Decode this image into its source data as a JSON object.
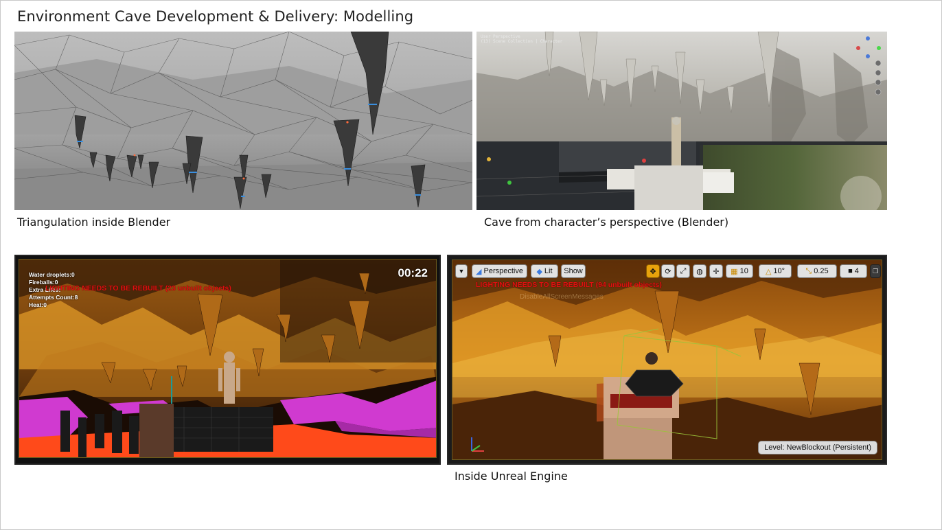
{
  "slide": {
    "title": "Environment Cave Development & Delivery: Modelling",
    "captions": {
      "blender_triangulation": "Triangulation inside Blender",
      "blender_character": "Cave from character’s perspective (Blender)",
      "unreal": "Inside Unreal Engine"
    }
  },
  "blender_view": {
    "overlay_title": "User Perspective",
    "overlay_collection": "(13) Scene Collection | Character"
  },
  "game_view": {
    "hud": {
      "water_droplets": "Water droplets:0",
      "fireballs": "Fireballs:0",
      "extra_lives": "Extra Lifes:",
      "attempts": "Attempts Count:8",
      "heat": "Heat:0"
    },
    "warning": "LIGHTING NEEDS TO BE REBUILT (23 unbuilt objects)",
    "timer": "00:22"
  },
  "unreal_editor": {
    "toolbar": {
      "perspective_label": "Perspective",
      "lit_label": "Lit",
      "show_label": "Show",
      "grid_value": "10",
      "angle_value": "10°",
      "scale_value": "0.25",
      "camera_speed": "4"
    },
    "warning": "LIGHTING NEEDS TO BE REBUILT (94 unbuilt objects)",
    "ghost_text": "DisableAllScreenMessages",
    "level_label": "Level:  NewBlockout (Persistent)"
  },
  "colors": {
    "game_magenta": "#d03ad0",
    "game_lava": "#ff4a1a",
    "cave_orange": "#b86a12",
    "warning_red": "#e01010",
    "ue_accent": "#e8a20c"
  }
}
